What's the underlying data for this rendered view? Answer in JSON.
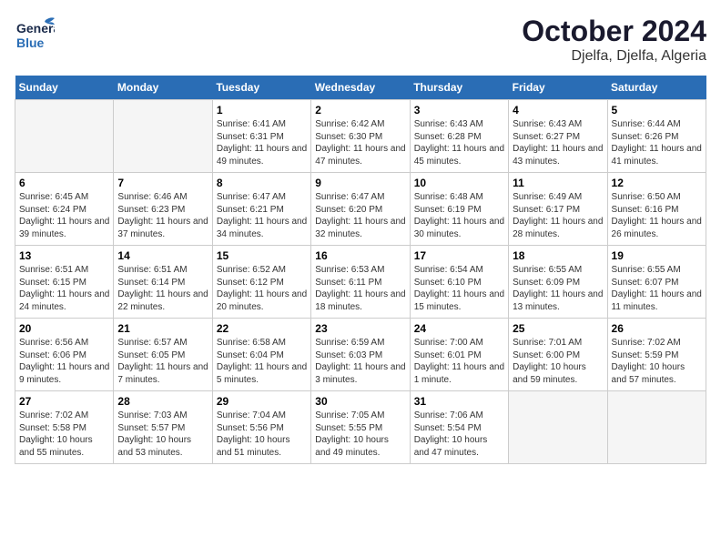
{
  "header": {
    "logo_line1": "General",
    "logo_line2": "Blue",
    "title": "October 2024",
    "subtitle": "Djelfa, Djelfa, Algeria"
  },
  "calendar": {
    "days_of_week": [
      "Sunday",
      "Monday",
      "Tuesday",
      "Wednesday",
      "Thursday",
      "Friday",
      "Saturday"
    ],
    "weeks": [
      [
        {
          "day": "",
          "info": ""
        },
        {
          "day": "",
          "info": ""
        },
        {
          "day": "1",
          "info": "Sunrise: 6:41 AM\nSunset: 6:31 PM\nDaylight: 11 hours and 49 minutes."
        },
        {
          "day": "2",
          "info": "Sunrise: 6:42 AM\nSunset: 6:30 PM\nDaylight: 11 hours and 47 minutes."
        },
        {
          "day": "3",
          "info": "Sunrise: 6:43 AM\nSunset: 6:28 PM\nDaylight: 11 hours and 45 minutes."
        },
        {
          "day": "4",
          "info": "Sunrise: 6:43 AM\nSunset: 6:27 PM\nDaylight: 11 hours and 43 minutes."
        },
        {
          "day": "5",
          "info": "Sunrise: 6:44 AM\nSunset: 6:26 PM\nDaylight: 11 hours and 41 minutes."
        }
      ],
      [
        {
          "day": "6",
          "info": "Sunrise: 6:45 AM\nSunset: 6:24 PM\nDaylight: 11 hours and 39 minutes."
        },
        {
          "day": "7",
          "info": "Sunrise: 6:46 AM\nSunset: 6:23 PM\nDaylight: 11 hours and 37 minutes."
        },
        {
          "day": "8",
          "info": "Sunrise: 6:47 AM\nSunset: 6:21 PM\nDaylight: 11 hours and 34 minutes."
        },
        {
          "day": "9",
          "info": "Sunrise: 6:47 AM\nSunset: 6:20 PM\nDaylight: 11 hours and 32 minutes."
        },
        {
          "day": "10",
          "info": "Sunrise: 6:48 AM\nSunset: 6:19 PM\nDaylight: 11 hours and 30 minutes."
        },
        {
          "day": "11",
          "info": "Sunrise: 6:49 AM\nSunset: 6:17 PM\nDaylight: 11 hours and 28 minutes."
        },
        {
          "day": "12",
          "info": "Sunrise: 6:50 AM\nSunset: 6:16 PM\nDaylight: 11 hours and 26 minutes."
        }
      ],
      [
        {
          "day": "13",
          "info": "Sunrise: 6:51 AM\nSunset: 6:15 PM\nDaylight: 11 hours and 24 minutes."
        },
        {
          "day": "14",
          "info": "Sunrise: 6:51 AM\nSunset: 6:14 PM\nDaylight: 11 hours and 22 minutes."
        },
        {
          "day": "15",
          "info": "Sunrise: 6:52 AM\nSunset: 6:12 PM\nDaylight: 11 hours and 20 minutes."
        },
        {
          "day": "16",
          "info": "Sunrise: 6:53 AM\nSunset: 6:11 PM\nDaylight: 11 hours and 18 minutes."
        },
        {
          "day": "17",
          "info": "Sunrise: 6:54 AM\nSunset: 6:10 PM\nDaylight: 11 hours and 15 minutes."
        },
        {
          "day": "18",
          "info": "Sunrise: 6:55 AM\nSunset: 6:09 PM\nDaylight: 11 hours and 13 minutes."
        },
        {
          "day": "19",
          "info": "Sunrise: 6:55 AM\nSunset: 6:07 PM\nDaylight: 11 hours and 11 minutes."
        }
      ],
      [
        {
          "day": "20",
          "info": "Sunrise: 6:56 AM\nSunset: 6:06 PM\nDaylight: 11 hours and 9 minutes."
        },
        {
          "day": "21",
          "info": "Sunrise: 6:57 AM\nSunset: 6:05 PM\nDaylight: 11 hours and 7 minutes."
        },
        {
          "day": "22",
          "info": "Sunrise: 6:58 AM\nSunset: 6:04 PM\nDaylight: 11 hours and 5 minutes."
        },
        {
          "day": "23",
          "info": "Sunrise: 6:59 AM\nSunset: 6:03 PM\nDaylight: 11 hours and 3 minutes."
        },
        {
          "day": "24",
          "info": "Sunrise: 7:00 AM\nSunset: 6:01 PM\nDaylight: 11 hours and 1 minute."
        },
        {
          "day": "25",
          "info": "Sunrise: 7:01 AM\nSunset: 6:00 PM\nDaylight: 10 hours and 59 minutes."
        },
        {
          "day": "26",
          "info": "Sunrise: 7:02 AM\nSunset: 5:59 PM\nDaylight: 10 hours and 57 minutes."
        }
      ],
      [
        {
          "day": "27",
          "info": "Sunrise: 7:02 AM\nSunset: 5:58 PM\nDaylight: 10 hours and 55 minutes."
        },
        {
          "day": "28",
          "info": "Sunrise: 7:03 AM\nSunset: 5:57 PM\nDaylight: 10 hours and 53 minutes."
        },
        {
          "day": "29",
          "info": "Sunrise: 7:04 AM\nSunset: 5:56 PM\nDaylight: 10 hours and 51 minutes."
        },
        {
          "day": "30",
          "info": "Sunrise: 7:05 AM\nSunset: 5:55 PM\nDaylight: 10 hours and 49 minutes."
        },
        {
          "day": "31",
          "info": "Sunrise: 7:06 AM\nSunset: 5:54 PM\nDaylight: 10 hours and 47 minutes."
        },
        {
          "day": "",
          "info": ""
        },
        {
          "day": "",
          "info": ""
        }
      ]
    ]
  }
}
